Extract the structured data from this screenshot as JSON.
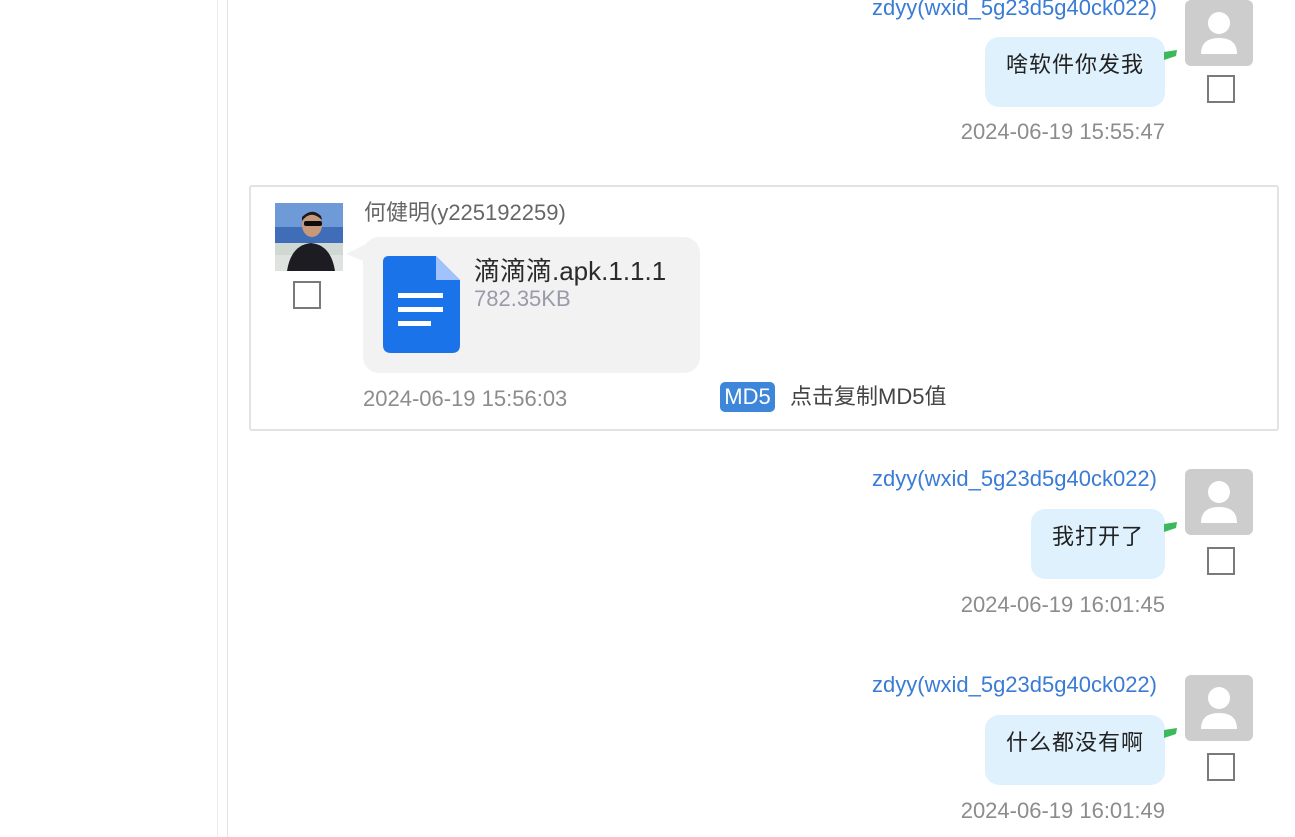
{
  "colors": {
    "link_blue": "#3a7bd5",
    "bubble_right_bg": "#dff1fd",
    "bubble_tail_green": "#3cb95a",
    "file_bubble_bg": "#f2f2f2",
    "file_icon_blue": "#1a73e8",
    "md5_badge_bg": "#3d86d9",
    "timestamp_gray": "#8c8c8c"
  },
  "messages": [
    {
      "side": "right",
      "sender": "zdyy(wxid_5g23d5g40ck022)",
      "avatar": "default-user-icon",
      "text": "啥软件你发我",
      "time": "2024-06-19 15:55:47"
    },
    {
      "side": "left",
      "sender": "何健明(y225192259)",
      "avatar": "photo-avatar",
      "file": {
        "name": "滴滴滴.apk.1.1.1",
        "size": "782.35KB",
        "icon": "document-file-icon"
      },
      "time": "2024-06-19 15:56:03",
      "md5_badge": "MD5",
      "md5_action": "点击复制MD5值"
    },
    {
      "side": "right",
      "sender": "zdyy(wxid_5g23d5g40ck022)",
      "avatar": "default-user-icon",
      "text": "我打开了",
      "time": "2024-06-19 16:01:45"
    },
    {
      "side": "right",
      "sender": "zdyy(wxid_5g23d5g40ck022)",
      "avatar": "default-user-icon",
      "text": "什么都没有啊",
      "time": "2024-06-19 16:01:49"
    }
  ]
}
